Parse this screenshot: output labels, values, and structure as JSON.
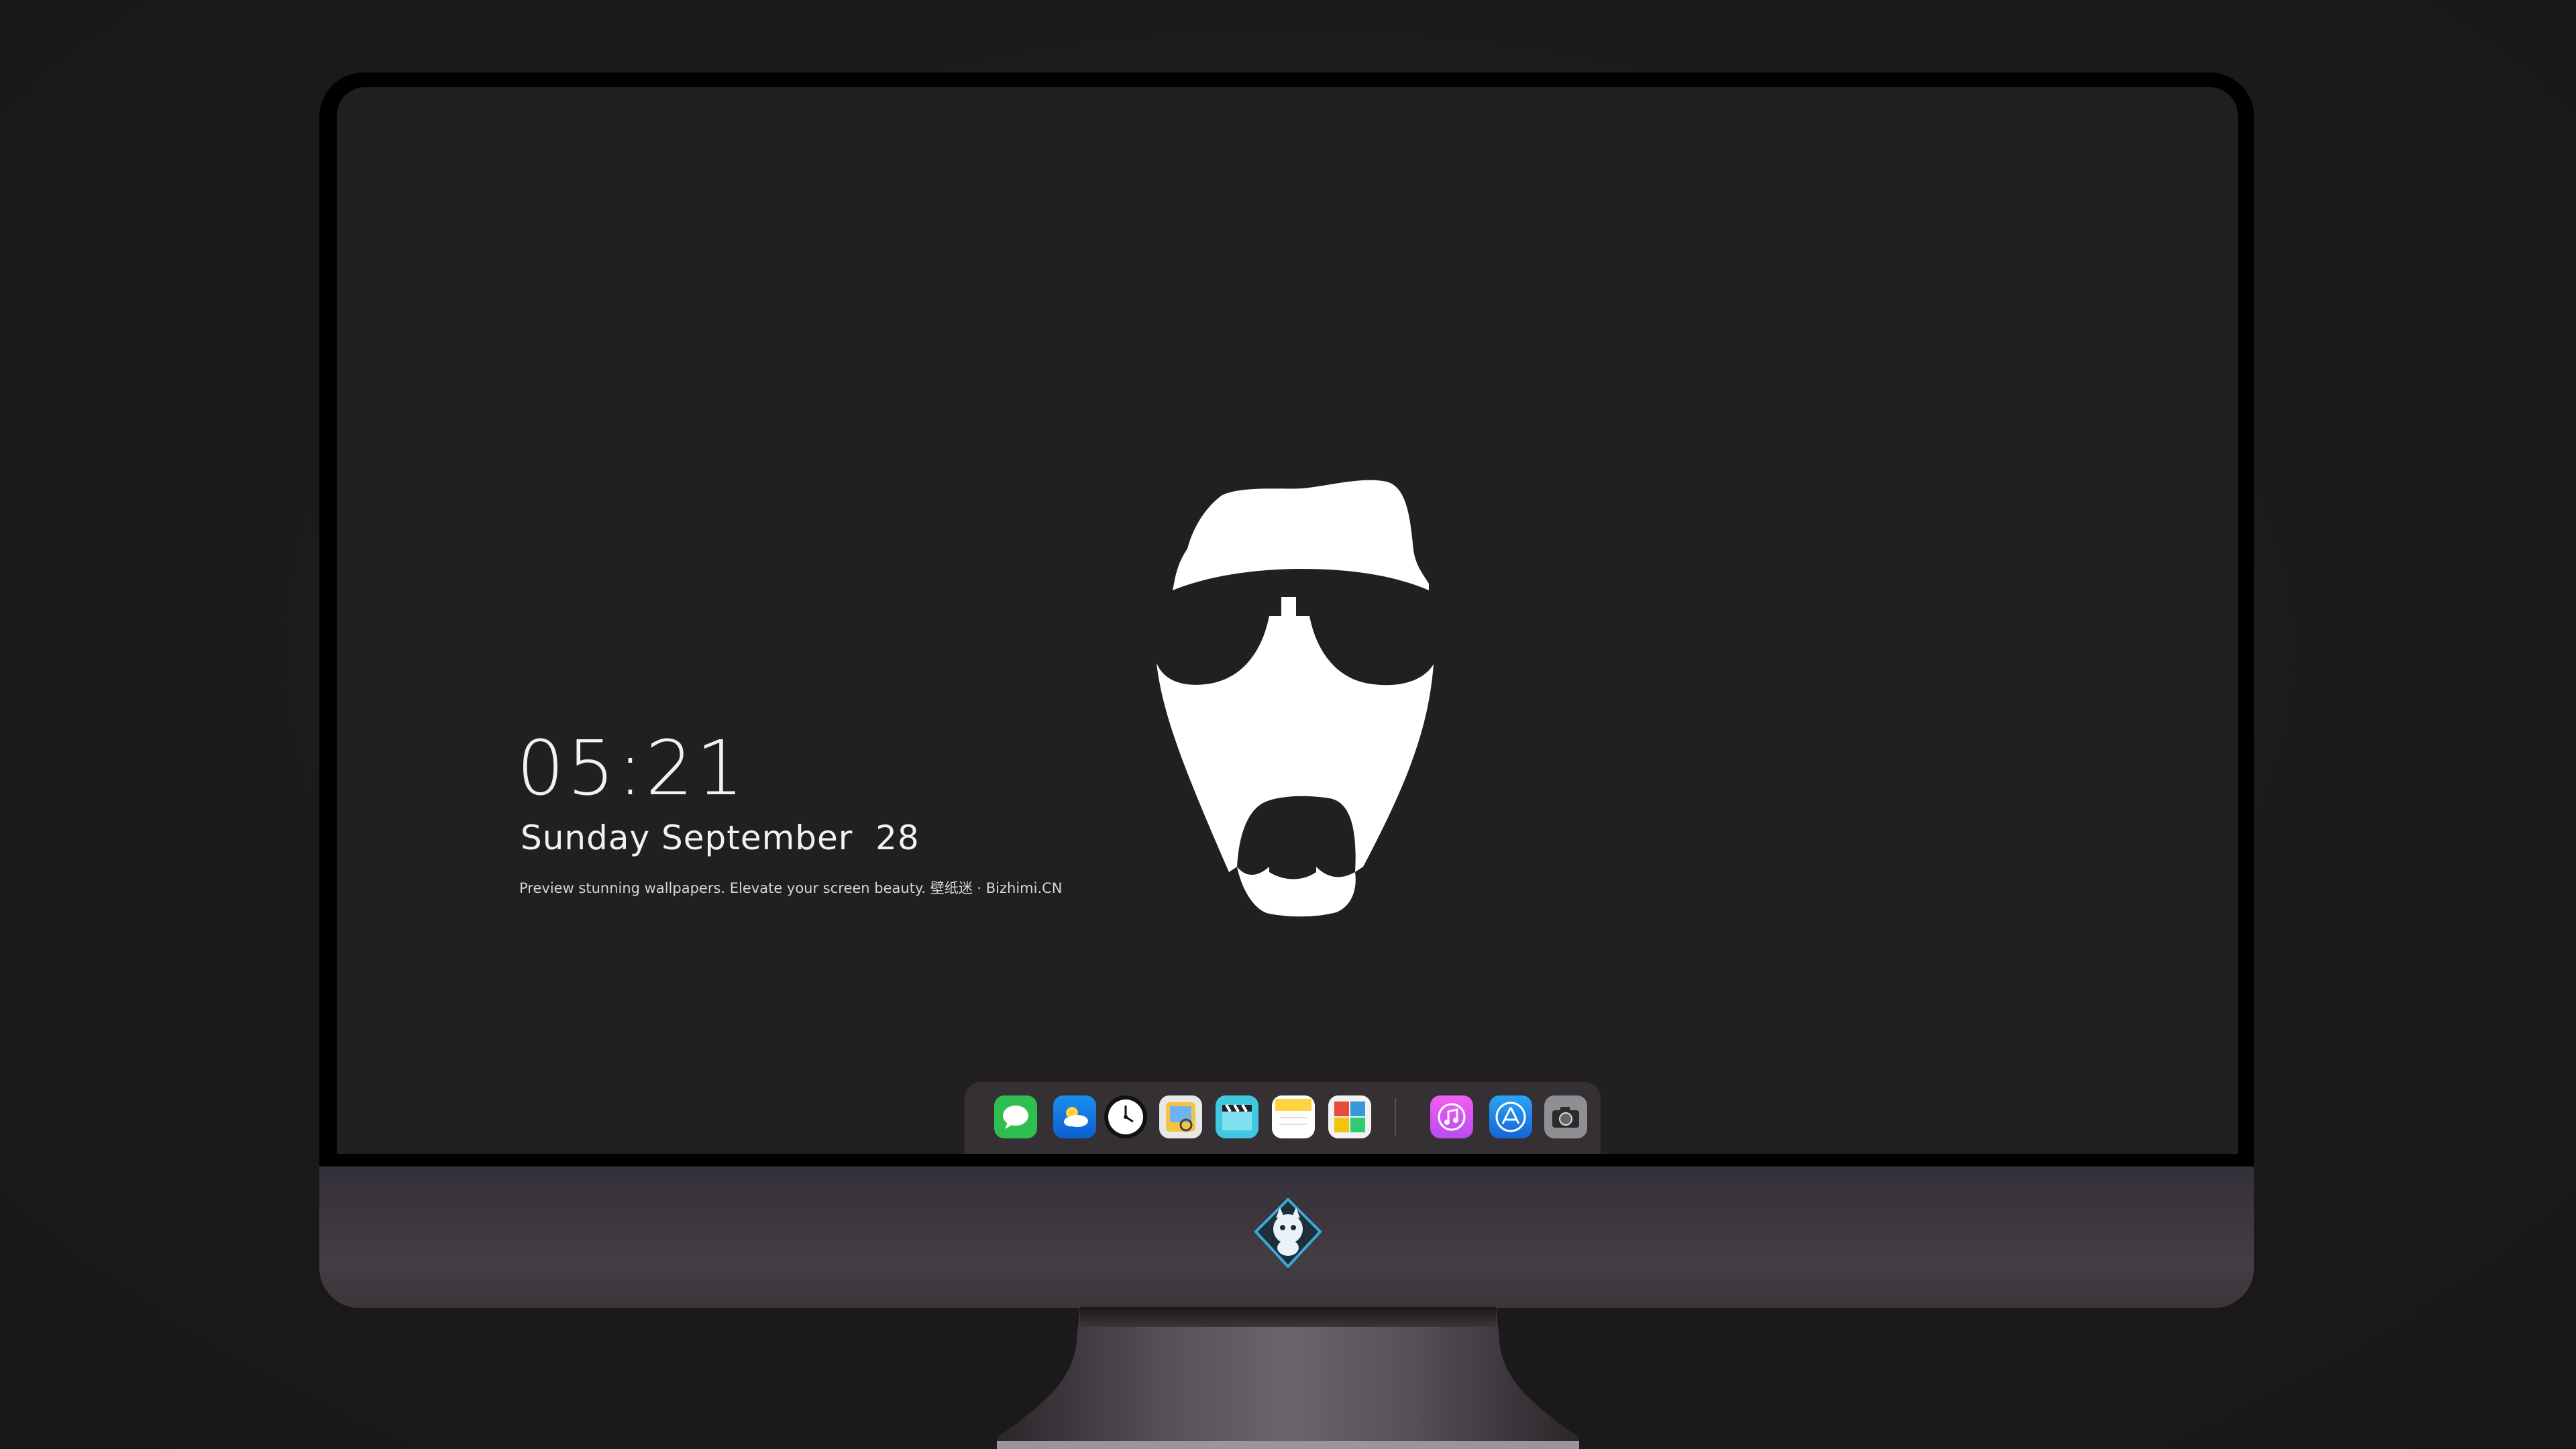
{
  "lockscreen": {
    "time": "05:21",
    "date": "Sunday September  28",
    "tagline": "Preview stunning wallpapers. Elevate your screen beauty. 壁纸迷 · Bizhimi.CN"
  },
  "wallpaper": {
    "subject": "bearded-man-with-sunglasses-logo",
    "background_color": "#221f21",
    "foreground_color": "#ffffff"
  },
  "dock": {
    "apps": [
      {
        "name": "messages-icon",
        "color": "#34c759"
      },
      {
        "name": "weather-icon",
        "color": "#1e88e5"
      },
      {
        "name": "clock-icon",
        "color": "#ffffff"
      },
      {
        "name": "preview-icon",
        "color": "#f4c542"
      },
      {
        "name": "clips-icon",
        "color": "#40c8e0"
      },
      {
        "name": "notes-icon",
        "color": "#ffd23f"
      },
      {
        "name": "photo-booth-icon",
        "color": "#4caf50"
      },
      {
        "name": "itunes-icon",
        "color": "#e040fb"
      },
      {
        "name": "app-store-icon",
        "color": "#1e88e5"
      },
      {
        "name": "camera-icon",
        "color": "#8e8e93"
      }
    ]
  },
  "monitor": {
    "chin_logo": "cat-astronaut-badge-icon"
  }
}
